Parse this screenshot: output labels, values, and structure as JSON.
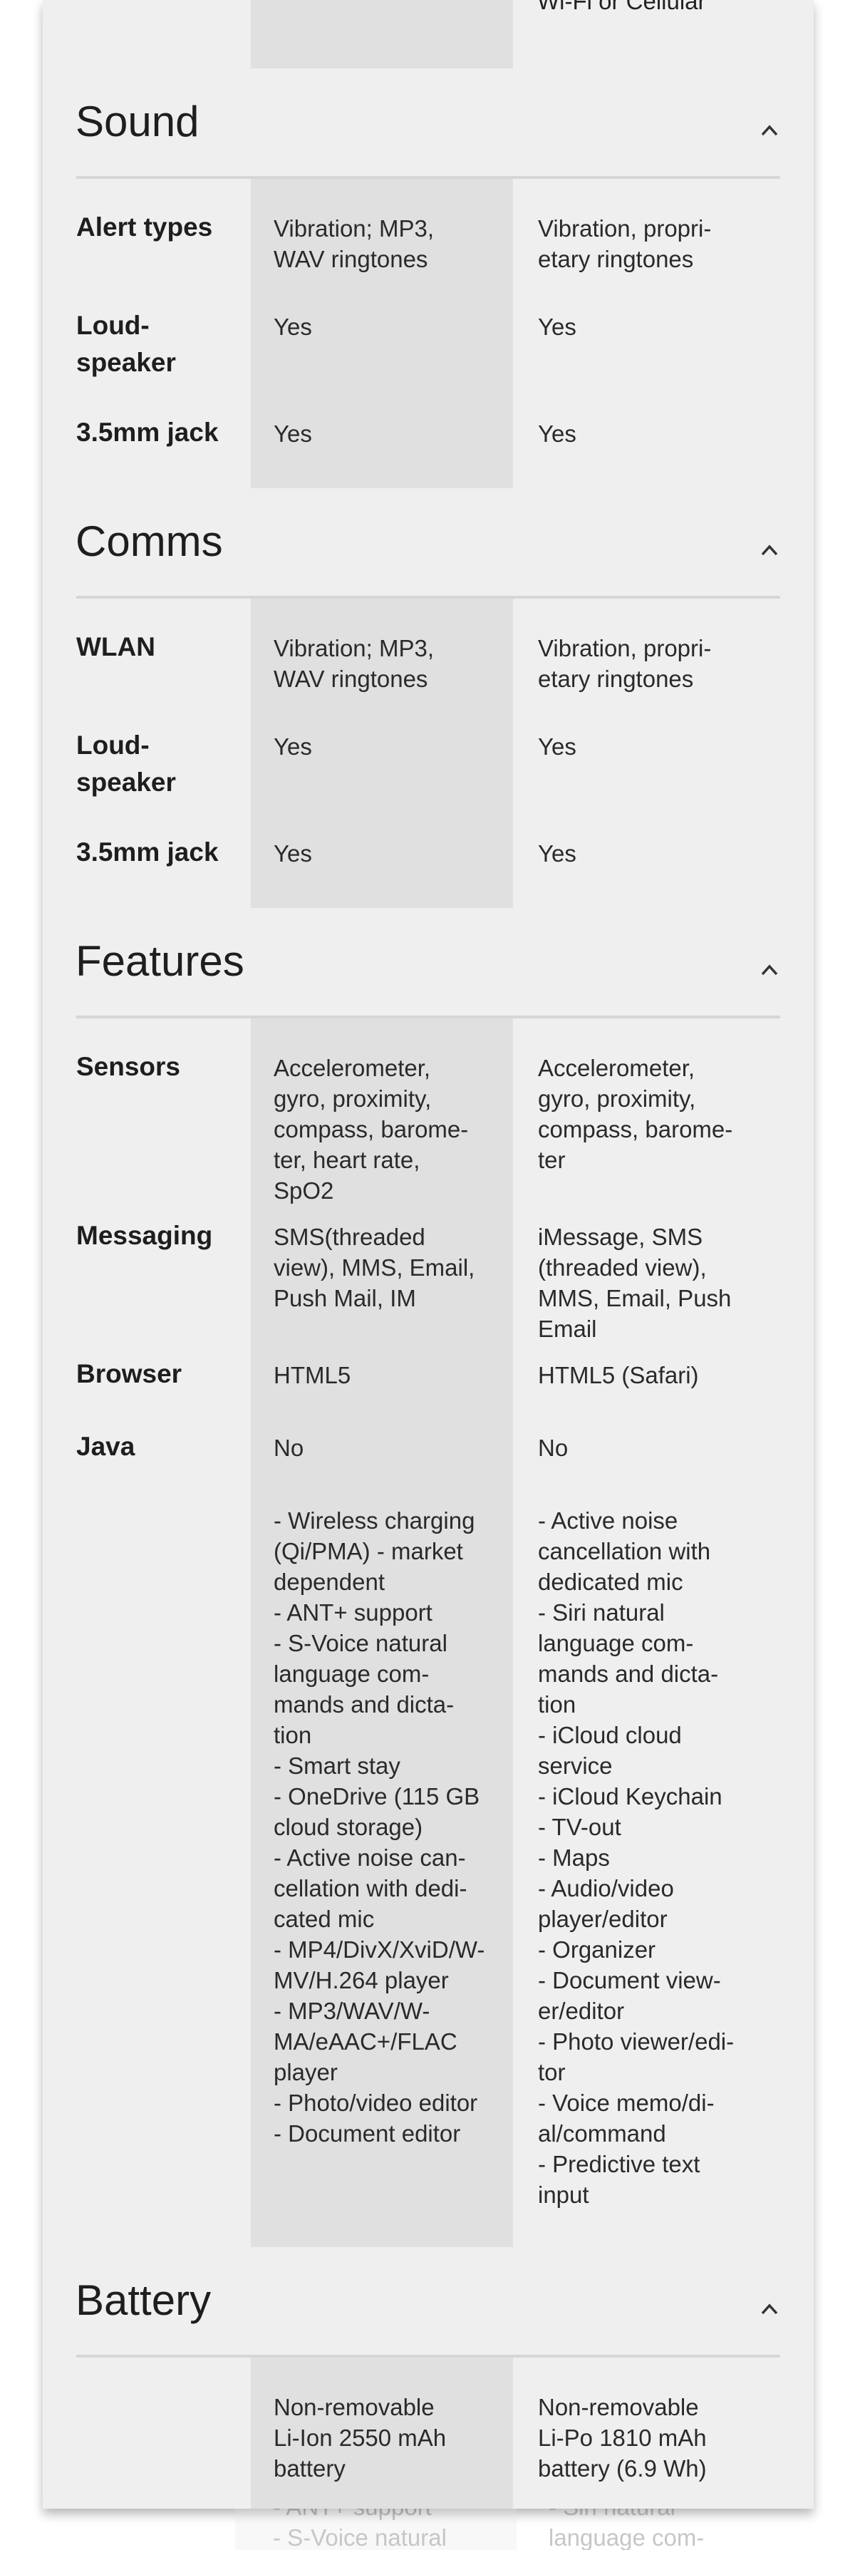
{
  "colors": {
    "card": "#efefef",
    "shaded_column": "#e0e0e0",
    "divider": "#d6d6d6",
    "text": "#222222"
  },
  "top": {
    "col2": [],
    "col3": [
      "Wi-Fi or Cellular"
    ]
  },
  "sections": [
    {
      "title": "Sound",
      "icon": "chevron-up-icon",
      "rows": [
        {
          "label": [
            "Alert types"
          ],
          "col2": [
            "Vibration; MP3,",
            "WAV ringtones"
          ],
          "col3": [
            "Vibration, propri-",
            "etary ringtones"
          ]
        },
        {
          "label": [
            "Loud-",
            "speaker"
          ],
          "col2": [
            "Yes"
          ],
          "col3": [
            "Yes"
          ]
        },
        {
          "label": [
            "3.5mm jack"
          ],
          "col2": [
            "Yes"
          ],
          "col3": [
            "Yes"
          ]
        }
      ]
    },
    {
      "title": "Comms",
      "icon": "chevron-up-icon",
      "rows": [
        {
          "label": [
            "WLAN"
          ],
          "col2": [
            "Vibration; MP3,",
            "WAV ringtones"
          ],
          "col3": [
            "Vibration, propri-",
            "etary ringtones"
          ]
        },
        {
          "label": [
            "Loud-",
            "speaker"
          ],
          "col2": [
            "Yes"
          ],
          "col3": [
            "Yes"
          ]
        },
        {
          "label": [
            "3.5mm jack"
          ],
          "col2": [
            "Yes"
          ],
          "col3": [
            "Yes"
          ]
        }
      ]
    },
    {
      "title": "Features",
      "icon": "chevron-up-icon",
      "rows": [
        {
          "label": [
            "Sensors"
          ],
          "col2": [
            "Accelerometer,",
            "gyro, proximity,",
            "compass, barome-",
            "ter, heart rate,",
            "SpO2"
          ],
          "col3": [
            "Accelerometer,",
            "gyro, proximity,",
            "compass, barome-",
            "ter"
          ]
        },
        {
          "label": [
            "Messaging"
          ],
          "col2": [
            "SMS(threaded",
            "view), MMS, Email,",
            "Push Mail, IM"
          ],
          "col3": [
            "iMessage, SMS",
            "(threaded view),",
            "MMS, Email, Push",
            "Email"
          ]
        },
        {
          "label": [
            "Browser"
          ],
          "col2": [
            "HTML5"
          ],
          "col3": [
            "HTML5 (Safari)"
          ]
        },
        {
          "label": [
            "Java"
          ],
          "col2": [
            "No"
          ],
          "col3": [
            "No"
          ]
        },
        {
          "label": [],
          "col2": [
            "- Wireless charging",
            "(Qi/PMA) - market",
            "dependent",
            "- ANT+ support",
            "- S-Voice natural",
            "language com-",
            "mands and dicta-",
            "tion",
            "- Smart stay",
            "- OneDrive (115 GB",
            "cloud storage)",
            "- Active noise can-",
            "cellation with dedi-",
            "cated mic",
            "- MP4/DivX/XviD/W-",
            "MV/H.264 player",
            "- MP3/WAV/W-",
            "MA/eAAC+/FLAC",
            "player",
            "- Photo/video editor",
            "- Document editor"
          ],
          "col3": [
            "- Active noise",
            "cancellation with",
            "dedicated mic",
            "- Siri natural",
            "language com-",
            "mands and dicta-",
            "tion",
            "- iCloud cloud",
            "service",
            "- iCloud Keychain",
            "- TV-out",
            "- Maps",
            "- Audio/video",
            "player/editor",
            "- Organizer",
            "- Document view-",
            "er/editor",
            "- Photo viewer/edi-",
            "tor",
            "- Voice memo/di-",
            "al/command",
            "- Predictive text",
            "input"
          ]
        }
      ]
    },
    {
      "title": "Battery",
      "icon": "chevron-up-icon",
      "rows": [
        {
          "label": [],
          "col2": [
            "Non-removable",
            "Li-Ion 2550 mAh",
            "battery"
          ],
          "col3": [
            "Non-removable",
            "Li-Po 1810 mAh",
            "battery (6.9 Wh)"
          ]
        }
      ]
    }
  ],
  "reflection": {
    "col2": [
      "- ANT+ support",
      "- S-Voice natural"
    ],
    "col3": [
      "- Siri natural",
      "language com-"
    ]
  }
}
